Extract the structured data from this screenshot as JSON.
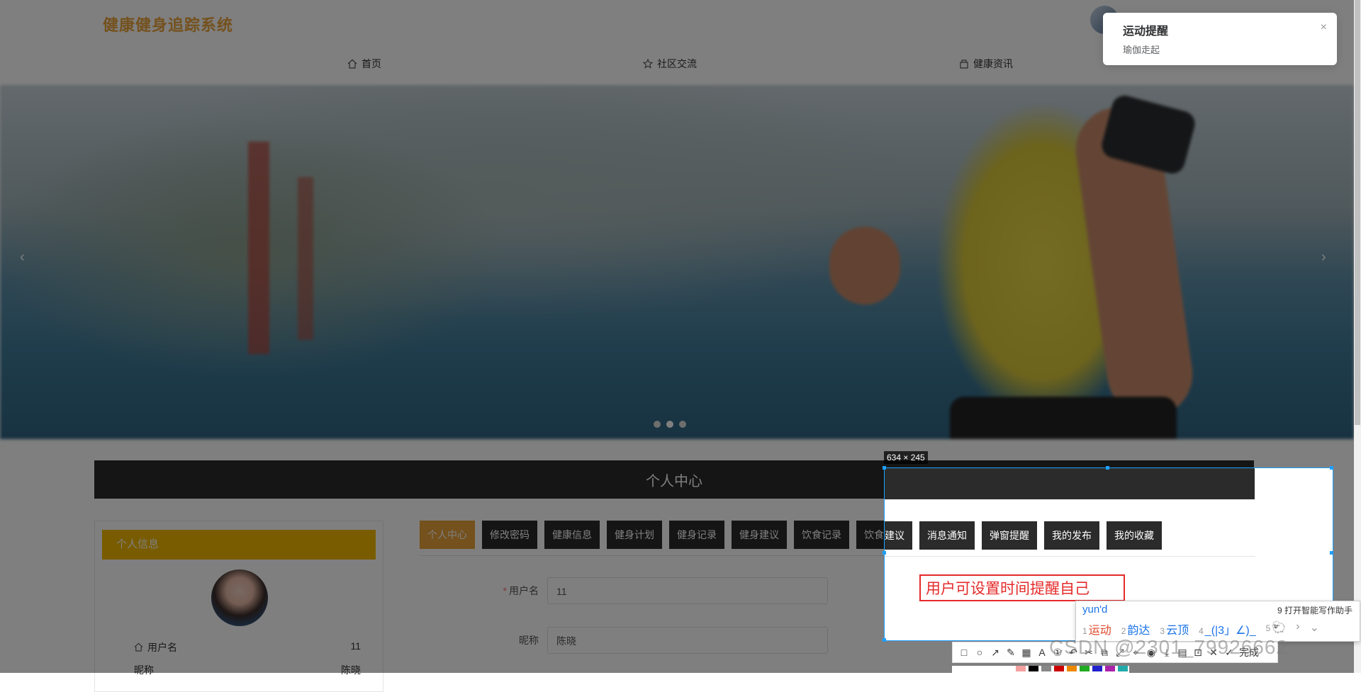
{
  "header": {
    "logo": "健康健身追踪系统",
    "nav": [
      {
        "label": "首页",
        "icon": "home-icon"
      },
      {
        "label": "社区交流",
        "icon": "star-icon"
      },
      {
        "label": "健康资讯",
        "icon": "news-icon"
      }
    ]
  },
  "banner": {
    "prev": "‹",
    "next": "›",
    "active_dot": 1,
    "dot_count": 3
  },
  "section_title": "个人中心",
  "profile": {
    "header": "个人信息",
    "username_label": "用户名",
    "username_value": "11",
    "nickname_label": "昵称",
    "nickname_value": "陈晓"
  },
  "tabs": [
    "个人中心",
    "修改密码",
    "健康信息",
    "健身计划",
    "健身记录",
    "健身建议",
    "饮食记录",
    "饮食建议",
    "消息通知",
    "弹窗提醒",
    "我的发布",
    "我的收藏"
  ],
  "form": {
    "username_label": "用户名",
    "username_value": "11",
    "nickname_label": "昵称",
    "nickname_value": "陈晓"
  },
  "toast": {
    "title": "运动提醒",
    "body": "瑜伽走起",
    "close": "×"
  },
  "capture": {
    "size_label": "634 × 245",
    "annotation": "用户可设置时间提醒自己"
  },
  "ime": {
    "input": "yun'd",
    "assist": "9 打开智能写作助手",
    "candidates": [
      {
        "n": "1",
        "text": "运动"
      },
      {
        "n": "2",
        "text": "韵达"
      },
      {
        "n": "3",
        "text": "云顶"
      },
      {
        "n": "4",
        "text": "_(|3」∠)_"
      },
      {
        "n": "5",
        "text": "🐑"
      }
    ]
  },
  "toolbar": {
    "done": "完成"
  },
  "watermark": "CSDN @2301_79926662",
  "colors": {
    "accent": "#e9a23b",
    "dark": "#2b2b2b",
    "annotation": "#e52a2a",
    "selection": "#1e9fff"
  }
}
